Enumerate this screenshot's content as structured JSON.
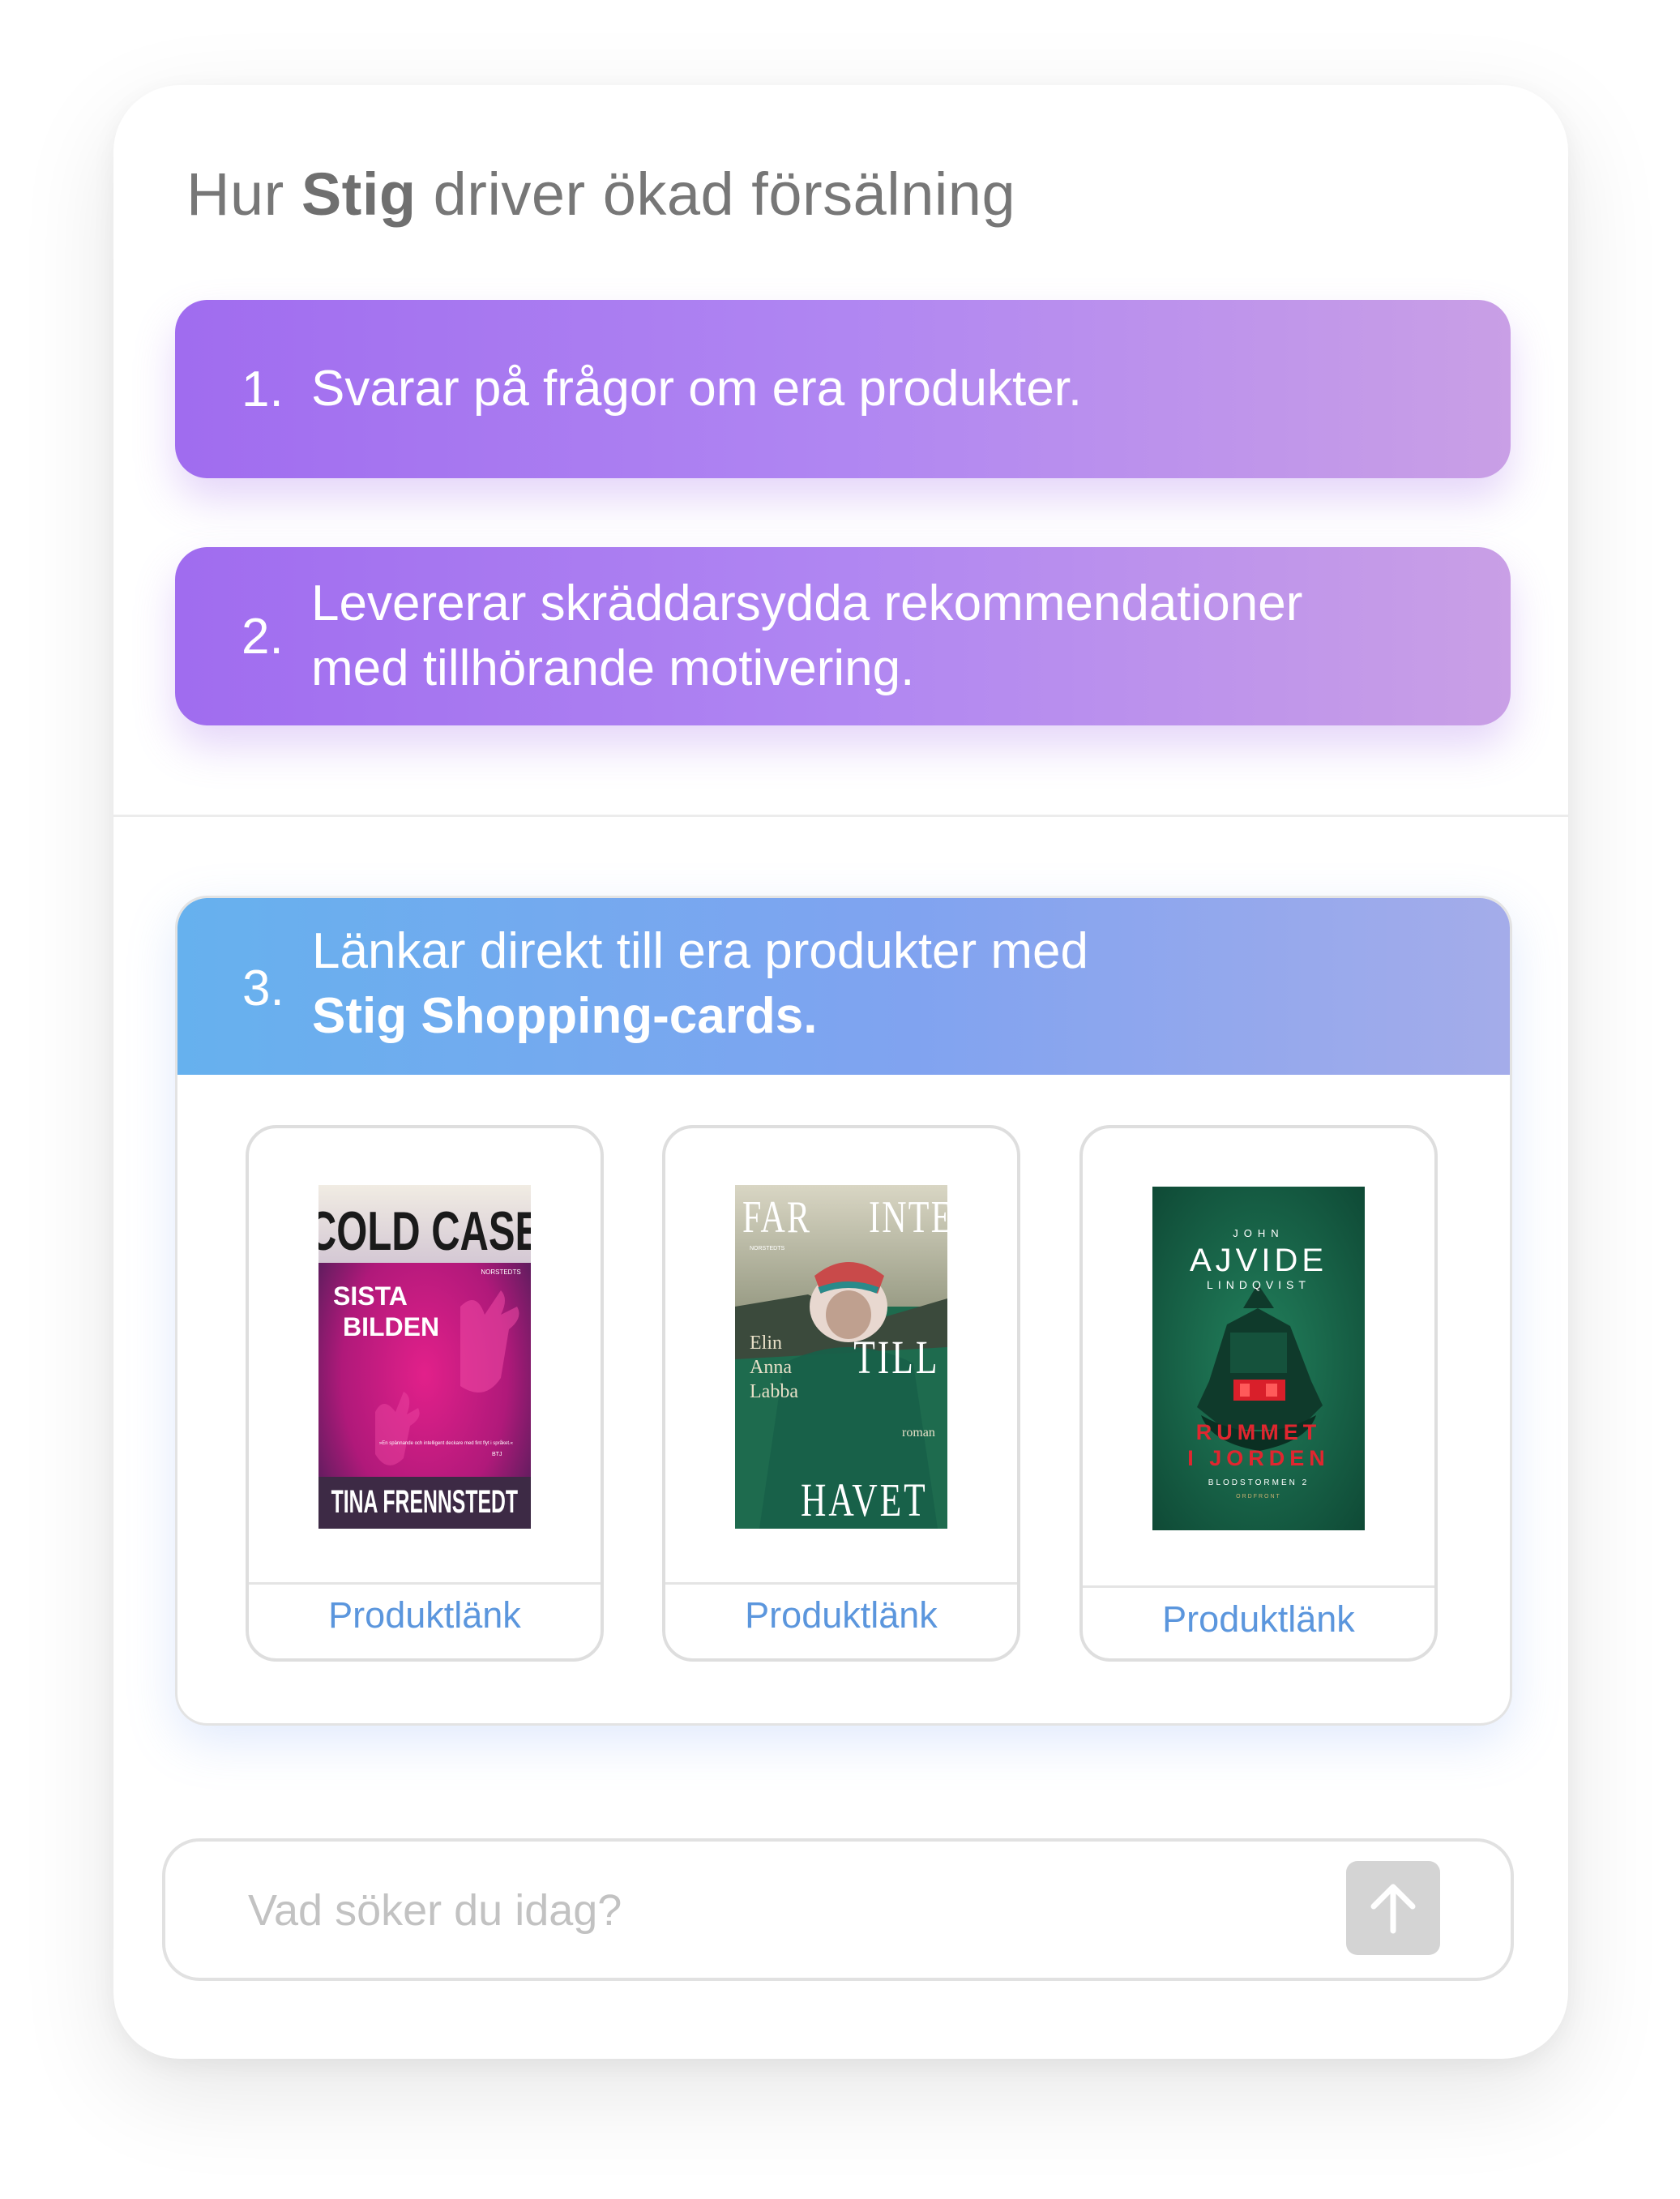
{
  "header": {
    "title_prefix": "Hur",
    "title_brand": "Stig",
    "title_suffix": "driver ökad försälning"
  },
  "features": [
    {
      "number": "1.",
      "line1": "Svarar på frågor om era produkter.",
      "line2": ""
    },
    {
      "number": "2.",
      "line1": "Levererar skräddarsydda rekommendationer",
      "line2": "med tillhörande motivering."
    },
    {
      "number": "3.",
      "line1": "Länkar direkt till era produkter med",
      "line2": "Stig Shopping-cards."
    }
  ],
  "products": [
    {
      "link_label": "Produktlänk",
      "cover": {
        "top": "COLD CASE",
        "publisher": "NORSTEDTS",
        "title1": "SISTA",
        "title2": "BILDEN",
        "quote": "»En spännande och intelligent deckare med fint flyt i språket.«",
        "quote_source": "BTJ",
        "author": "TINA FRENNSTEDT"
      }
    },
    {
      "link_label": "Produktlänk",
      "cover": {
        "word1": "FAR",
        "word2": "INTE",
        "word3": "TILL",
        "word4": "HAVET",
        "publisher": "NORSTEDTS",
        "author1": "Elin",
        "author2": "Anna",
        "author3": "Labba",
        "genre": "roman"
      }
    },
    {
      "link_label": "Produktlänk",
      "cover": {
        "author_first": "JOHN",
        "author_main": "AJVIDE",
        "author_last": "LINDQVIST",
        "title1": "RUMMET",
        "title2": "I JORDEN",
        "series": "BLODSTORMEN 2",
        "publisher": "ORDFRONT"
      }
    }
  ],
  "search": {
    "placeholder": "Vad söker du idag?",
    "send_icon": "arrow-up-icon"
  },
  "colors": {
    "purple_gradient": [
      "#a06cef",
      "#c99fe6"
    ],
    "blue_gradient": [
      "#66b1ee",
      "#a4acea"
    ],
    "link": "#5b96dd"
  }
}
